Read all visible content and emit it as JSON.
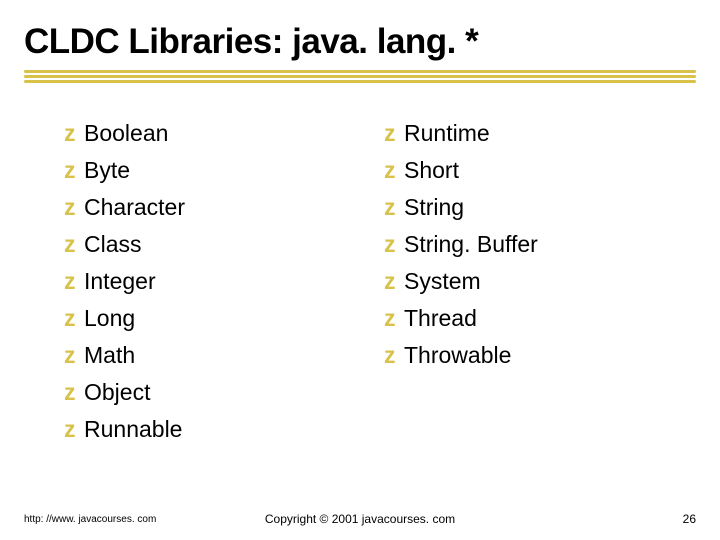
{
  "title": "CLDC Libraries: java. lang. *",
  "columns": {
    "left": [
      "Boolean",
      "Byte",
      "Character",
      "Class",
      "Integer",
      "Long",
      "Math",
      "Object",
      "Runnable"
    ],
    "right": [
      "Runtime",
      "Short",
      "String",
      "String. Buffer",
      "System",
      "Thread",
      "Throwable"
    ]
  },
  "footer": {
    "url": "http: //www. javacourses. com",
    "copyright": "Copyright © 2001 javacourses. com",
    "page": "26"
  }
}
